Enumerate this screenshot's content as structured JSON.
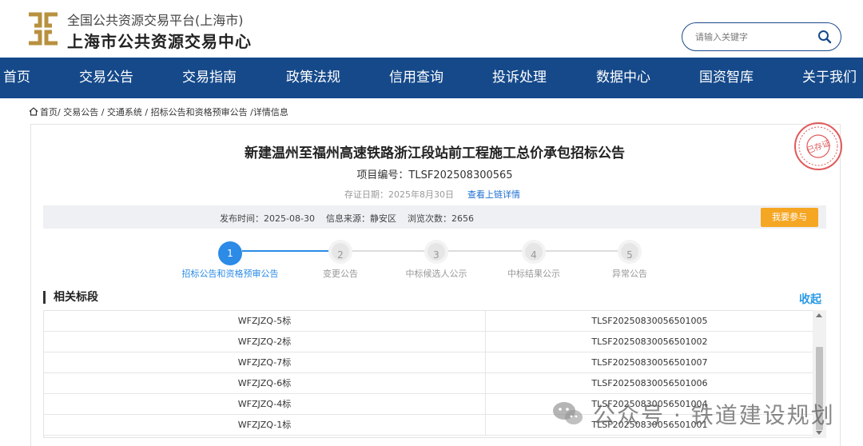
{
  "header": {
    "site_line1": "全国公共资源交易平台(上海市)",
    "site_line2": "上海市公共资源交易中心",
    "search_placeholder": "请输入关键字",
    "logo_color": "#b8913f"
  },
  "nav": {
    "items": [
      "首页",
      "交易公告",
      "交易指南",
      "政策法规",
      "信用查询",
      "投诉处理",
      "数据中心",
      "国资智库",
      "关于我们"
    ],
    "bg_color": "#15498a"
  },
  "breadcrumb": {
    "items": [
      "首页/",
      " 交易公告 /",
      " 交通系统 /",
      " 招标公告和资格预审公告 /",
      "详情信息"
    ]
  },
  "notice": {
    "title": "新建温州至福州高速铁路浙江段站前工程施工总价承包招标公告",
    "project_no": "项目编号：TLSF202508300565",
    "evidence_date": "存证日期：2025年8月30日",
    "chain_link": "查看上链详情",
    "stamp_text": "已存证",
    "publish_time": "发布时间：2025-08-30",
    "source": "信息来源：静安区",
    "views": "浏览次数：2656",
    "join_label": "我要参与"
  },
  "steps": [
    {
      "num": "1",
      "label": "招标公告和资格预审公告",
      "active": true
    },
    {
      "num": "2",
      "label": "变更公告",
      "active": false
    },
    {
      "num": "3",
      "label": "中标候选人公示",
      "active": false
    },
    {
      "num": "4",
      "label": "中标结果公示",
      "active": false
    },
    {
      "num": "5",
      "label": "异常公告",
      "active": false
    }
  ],
  "related": {
    "title": "相关标段",
    "collapse_label": "收起",
    "rows": [
      {
        "name": "WFZJZQ-5标",
        "code": "TLSF20250830056501005"
      },
      {
        "name": "WFZJZQ-2标",
        "code": "TLSF20250830056501002"
      },
      {
        "name": "WFZJZQ-7标",
        "code": "TLSF20250830056501007"
      },
      {
        "name": "WFZJZQ-6标",
        "code": "TLSF20250830056501006"
      },
      {
        "name": "WFZJZQ-4标",
        "code": "TLSF20250830056501004"
      },
      {
        "name": "WFZJZQ-1标",
        "code": "TLSF20250830056501001"
      }
    ]
  },
  "watermark": {
    "text": "公众号 · 铁道建设规划"
  },
  "colors": {
    "accent_blue": "#2b8be6",
    "button_orange": "#f5a623",
    "stamp_red": "#e05a5a"
  }
}
